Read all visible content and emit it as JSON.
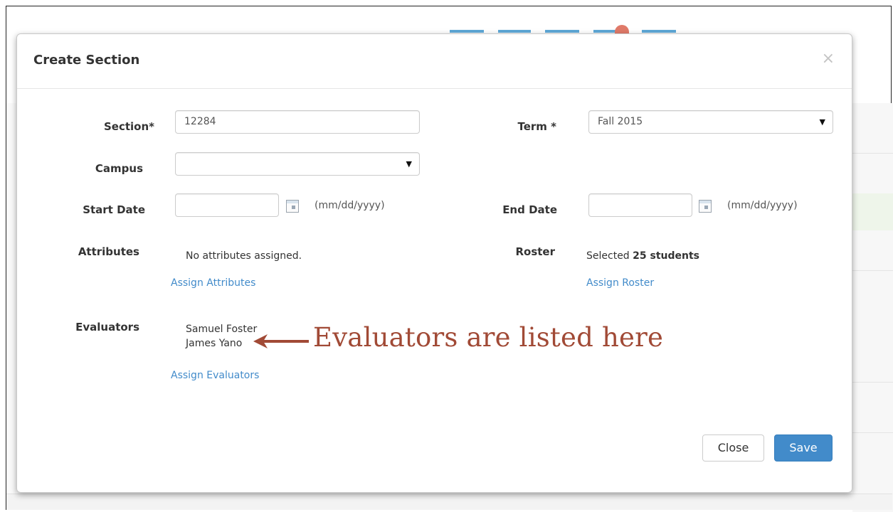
{
  "modal": {
    "title": "Create Section",
    "close_icon": "×"
  },
  "form": {
    "section": {
      "label": "Section*",
      "value": "12284"
    },
    "term": {
      "label": "Term *",
      "value": "Fall 2015"
    },
    "campus": {
      "label": "Campus",
      "value": ""
    },
    "start_date": {
      "label": "Start Date",
      "value": "",
      "hint": "(mm/dd/yyyy)"
    },
    "end_date": {
      "label": "End Date",
      "value": "",
      "hint": "(mm/dd/yyyy)"
    },
    "attributes": {
      "label": "Attributes",
      "status": "No attributes assigned.",
      "link": "Assign Attributes"
    },
    "roster": {
      "label": "Roster",
      "prefix": "Selected",
      "count": "25 students",
      "link": "Assign Roster"
    },
    "evaluators": {
      "label": "Evaluators",
      "names": [
        "Samuel Foster",
        "James Yano"
      ],
      "link": "Assign Evaluators"
    }
  },
  "annotation": {
    "text": "Evaluators are listed here",
    "color": "#a14a36"
  },
  "footer": {
    "close_label": "Close",
    "save_label": "Save"
  },
  "colors": {
    "primary": "#428bca",
    "link": "#428bca"
  },
  "icons": {
    "select_arrow": "▼",
    "calendar": "calendar-icon",
    "arrow": "left-arrow-icon"
  }
}
